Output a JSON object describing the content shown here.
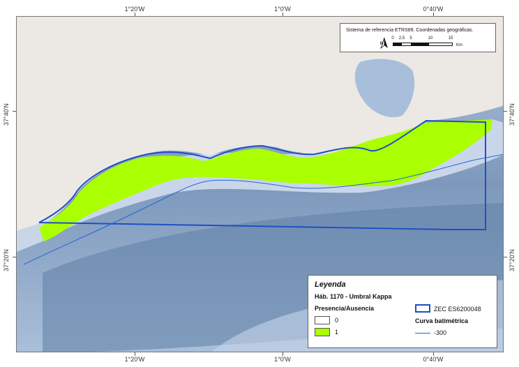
{
  "graticule": {
    "lon_labels": [
      "1°20'W",
      "1°0'W",
      "0°40'W"
    ],
    "lat_labels": [
      "37°40'N",
      "37°20'N"
    ]
  },
  "info_box": {
    "text": "Sistema de referencia ETRS89. Coordenadas geográficas.",
    "north": "N",
    "scale_labels": [
      "0",
      "2,5",
      "5",
      "10",
      "15"
    ],
    "scale_unit": "Km"
  },
  "legend": {
    "title": "Leyenda",
    "subtitle": "Háb. 1170 - Umbral Kappa",
    "presence_title": "Presencia/Ausencia",
    "class_0": "0",
    "class_1": "1",
    "zec_label": "ZEC ES6200048",
    "bathy_title": "Curva batimétrica",
    "bathy_value": "-300"
  },
  "colors": {
    "sea_shallow": "#c9d6ea",
    "sea_deep": "#5f7fa6",
    "land": "#ece8e4",
    "presence": "#aaff00",
    "zec_outline": "#1f4fc4",
    "bathy_line": "#1f64d8"
  }
}
